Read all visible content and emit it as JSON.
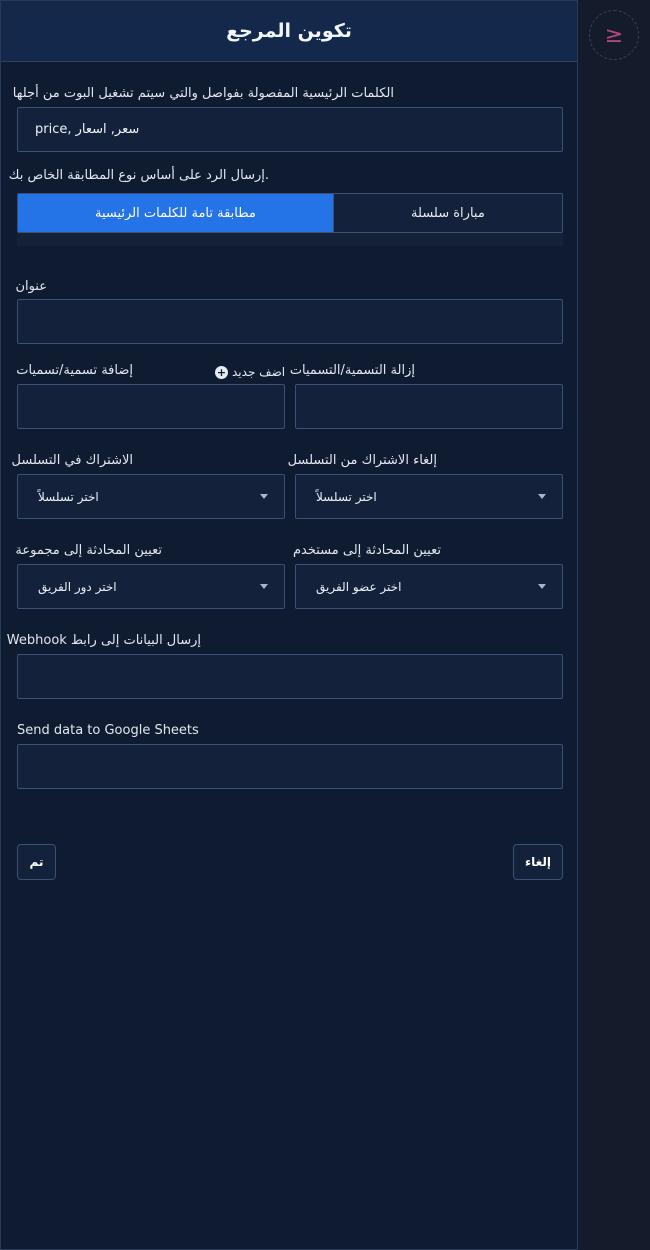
{
  "header": {
    "title": "تكوين المرجع"
  },
  "keywords": {
    "label": "الكلمات الرئيسية المفصولة بفواصل والتي سيتم تشغيل البوت من أجلها",
    "value": "سعر, اسعار ,price"
  },
  "match": {
    "label": ".إرسال الرد على أساس نوع المطابقة الخاص بك",
    "options": [
      "مطابقة تامة للكلمات الرئيسية",
      "مباراة سلسلة"
    ],
    "selected": "مطابقة تامة للكلمات الرئيسية"
  },
  "title_field": {
    "label": "عنوان",
    "value": ""
  },
  "add_labels": {
    "label": "إضافة تسمية/تسميات",
    "add_new": "اضف جديد",
    "value": ""
  },
  "remove_labels": {
    "label": "إزالة التسمية/التسميات",
    "value": ""
  },
  "subscribe_sequence": {
    "label": "الاشتراك في التسلسل",
    "selected": "اختر تسلسلاً"
  },
  "unsubscribe_sequence": {
    "label": "إلغاء الاشتراك من التسلسل",
    "selected": "اختر تسلسلاً"
  },
  "assign_group": {
    "label": "تعيين المحادثة إلى مجموعة",
    "selected": "اختر دور الفريق"
  },
  "assign_user": {
    "label": "تعيين المحادثة إلى مستخدم",
    "selected": "اختر عضو الفريق"
  },
  "webhook": {
    "label": "إرسال البيانات إلى رابط Webhook",
    "value": ""
  },
  "google_sheets": {
    "label": "Send data to Google Sheets",
    "value": ""
  },
  "buttons": {
    "done": "تم",
    "cancel": "إلغاء"
  },
  "side": {
    "icon": "greater-equal-icon",
    "glyph": "≥"
  },
  "colors": {
    "accent": "#2474e8",
    "panel": "#0f1b31",
    "header": "#13284a",
    "side_icon": "#b0487a"
  }
}
